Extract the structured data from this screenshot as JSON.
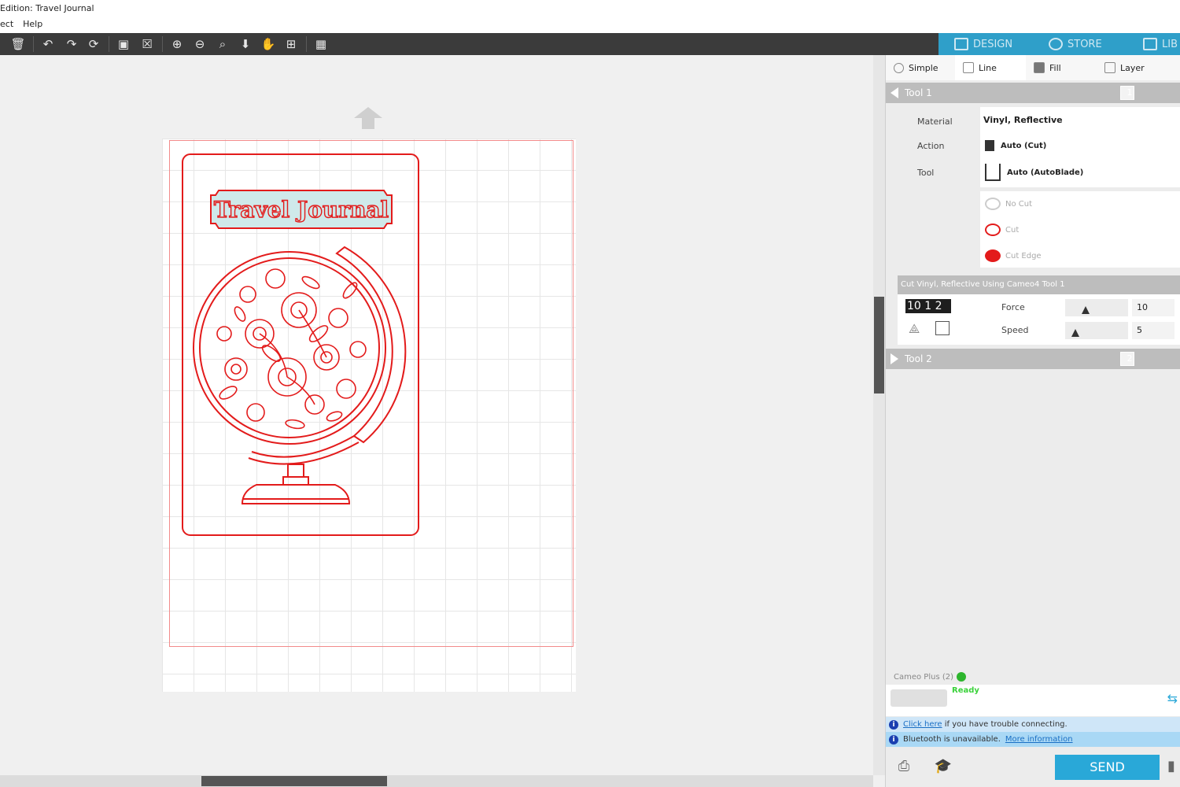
{
  "window": {
    "title": "Edition: Travel Journal",
    "menu": [
      "ect",
      "Help"
    ]
  },
  "toolbar": {
    "icons": [
      "delete-icon",
      "undo-icon",
      "redo-icon",
      "redraw-icon",
      "select-all-icon",
      "deselect-icon",
      "zoom-in-icon",
      "zoom-out-icon",
      "zoom-fit-icon",
      "move-down-icon",
      "pan-hand-icon",
      "fit-page-icon",
      "grid-icon"
    ]
  },
  "nav_tabs": [
    {
      "label": "DESIGN"
    },
    {
      "label": "STORE"
    },
    {
      "label": "LIB"
    }
  ],
  "design": {
    "banner_text": "Travel Journal",
    "colors": {
      "cut": "#e31b1b",
      "banner_fill": "#cfe9ea"
    }
  },
  "send_panel": {
    "modes": [
      "Simple",
      "Line",
      "Fill",
      "Layer"
    ],
    "tool1": {
      "label": "Tool 1",
      "number": "1"
    },
    "tool2": {
      "label": "Tool 2",
      "number": "2"
    },
    "labels": {
      "material": "Material",
      "action": "Action",
      "tool": "Tool"
    },
    "material_value": "Vinyl, Reflective",
    "action_value": "Auto (Cut)",
    "tool_value": "Auto (AutoBlade)",
    "cut_options": [
      "No Cut",
      "Cut",
      "Cut Edge"
    ],
    "summary": "Cut Vinyl, Reflective Using Cameo4 Tool 1",
    "blade_value": "10 1 2",
    "force_label": "Force",
    "force_value": "10",
    "speed_label": "Speed",
    "speed_value": "5",
    "force_fraction": 0.32,
    "speed_fraction": 0.16
  },
  "device": {
    "name": "Cameo Plus (2)",
    "status": "Ready"
  },
  "info": {
    "line1_link": "Click here",
    "line1_text": " if you have trouble connecting.",
    "line2_text": "Bluetooth is unavailable.",
    "line2_link": "More information"
  },
  "send_button": "SEND"
}
